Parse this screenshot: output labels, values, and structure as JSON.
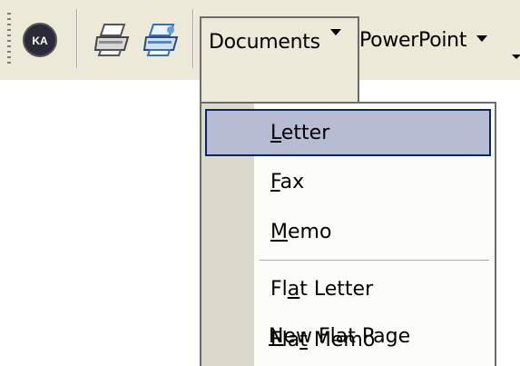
{
  "toolbar": {
    "buttons": [
      {
        "icon": "ka-logo-icon"
      },
      {
        "icon": "printer-icon"
      },
      {
        "icon": "print-color-icon"
      }
    ],
    "menus": [
      {
        "label": "Documents",
        "open": true
      },
      {
        "label": "PowerPoint",
        "open": false
      }
    ]
  },
  "dropdown": {
    "items": [
      {
        "pre": "",
        "mnemonic": "L",
        "post": "etter",
        "selected": true
      },
      {
        "pre": "",
        "mnemonic": "F",
        "post": "ax",
        "selected": false
      },
      {
        "pre": "",
        "mnemonic": "M",
        "post": "emo",
        "selected": false
      },
      {
        "pre": "Fl",
        "mnemonic": "a",
        "post": "t Letter",
        "selected": false
      },
      {
        "pre": "Fla",
        "mnemonic": "t",
        "post": " Memo",
        "selected": false
      },
      {
        "pre": "",
        "mnemonic": "N",
        "post": "ew Flat Page",
        "selected": false
      }
    ]
  },
  "colors": {
    "toolbar_bg": "#ece9d8",
    "menu_bg": "#fcfcf9",
    "gutter_bg": "#dcd9cc",
    "highlight_bg": "#b6bdd2",
    "highlight_border": "#0a246a"
  }
}
